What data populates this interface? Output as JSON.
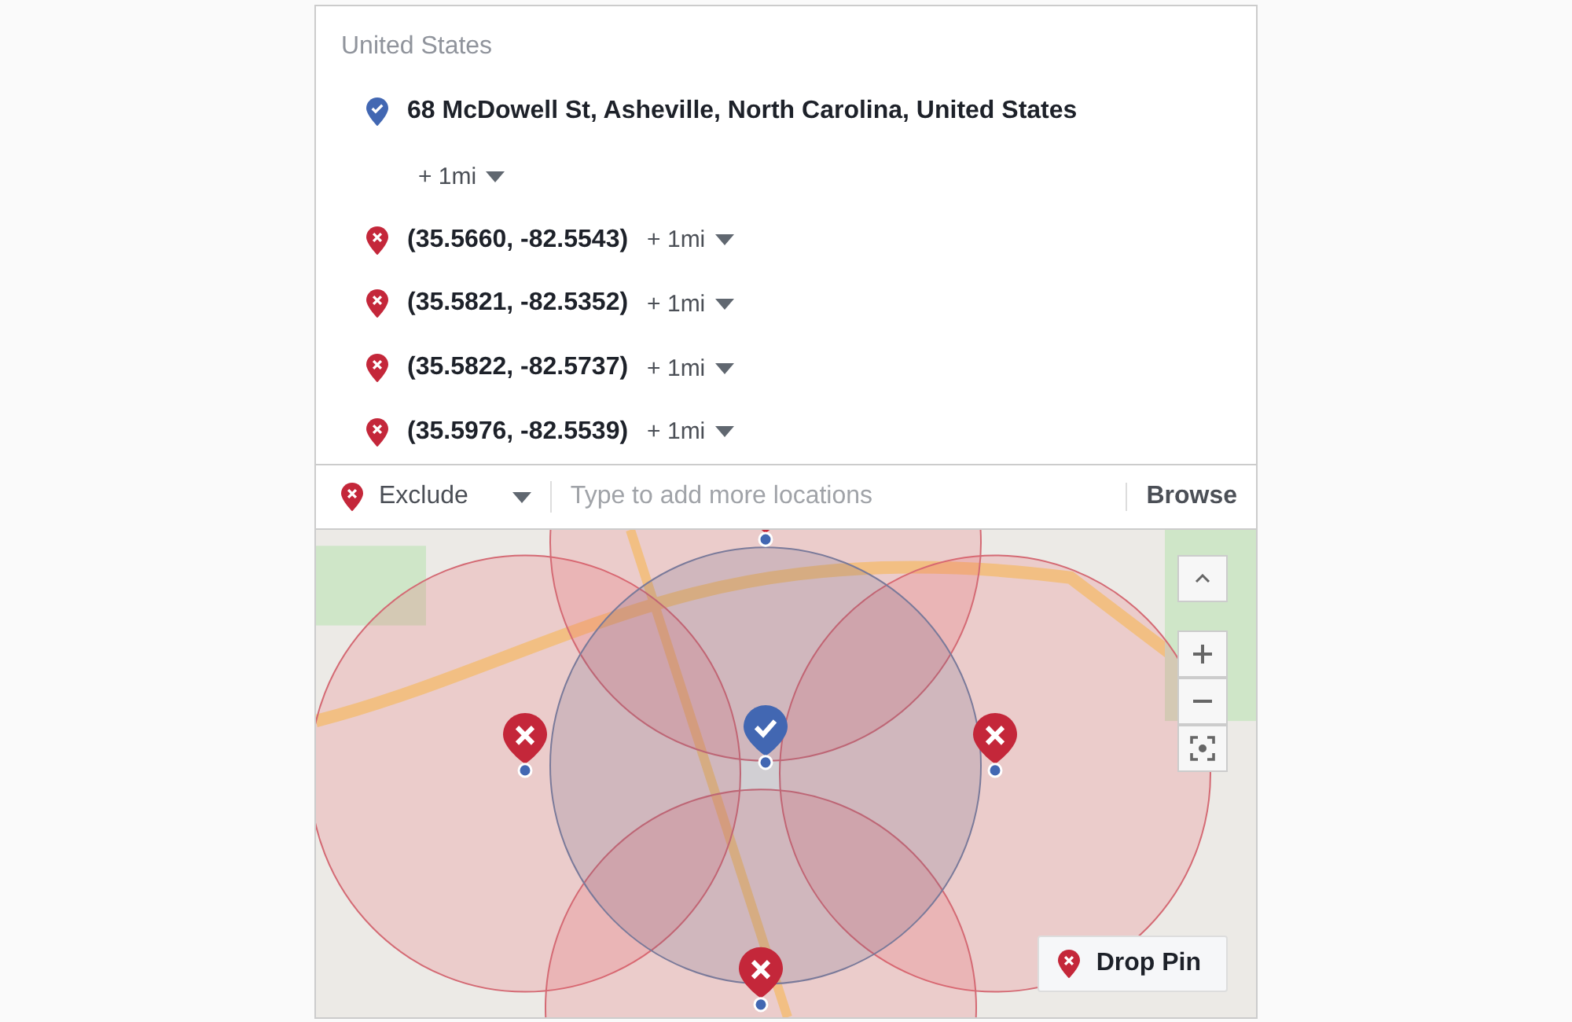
{
  "country": "United States",
  "locations": [
    {
      "kind": "include",
      "name": "68 McDowell St, Asheville, North Carolina, United States",
      "radius": "+ 1mi"
    },
    {
      "kind": "exclude",
      "name": "(35.5660, -82.5543)",
      "radius": "+ 1mi"
    },
    {
      "kind": "exclude",
      "name": "(35.5821, -82.5352)",
      "radius": "+ 1mi"
    },
    {
      "kind": "exclude",
      "name": "(35.5822, -82.5737)",
      "radius": "+ 1mi"
    },
    {
      "kind": "exclude",
      "name": "(35.5976, -82.5539)",
      "radius": "+ 1mi"
    }
  ],
  "search_bar": {
    "mode": "Exclude",
    "placeholder": "Type to add more locations",
    "browse": "Browse"
  },
  "map": {
    "drop_pin": "Drop Pin"
  }
}
